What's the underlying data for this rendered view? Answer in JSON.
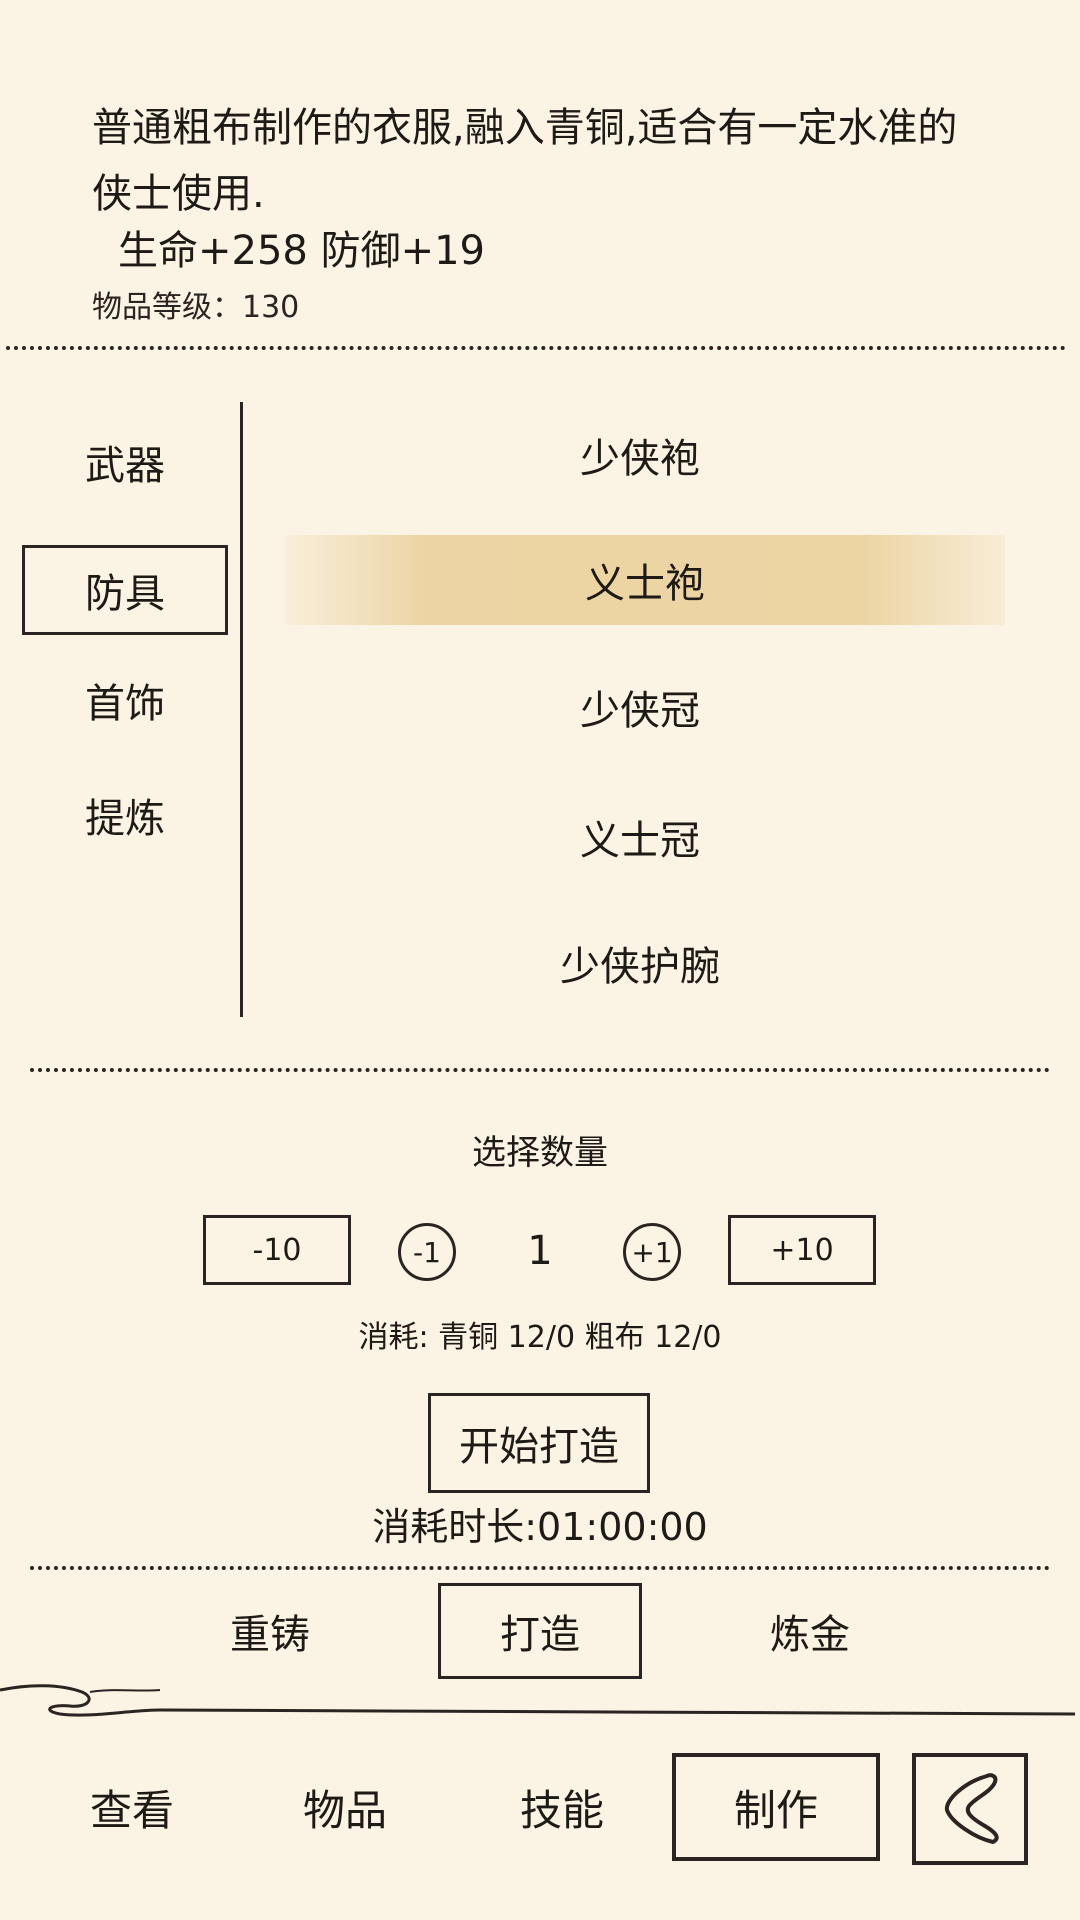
{
  "item_detail": {
    "description": "普通粗布制作的衣服,融入青铜,适合有一定水准的侠士使用.",
    "stats": "生命+258 防御+19",
    "level_text": "物品等级：130"
  },
  "categories": [
    {
      "label": "武器",
      "active": false
    },
    {
      "label": "防具",
      "active": true
    },
    {
      "label": "首饰",
      "active": false
    },
    {
      "label": "提炼",
      "active": false
    }
  ],
  "items": [
    {
      "label": "少侠袍",
      "selected": false
    },
    {
      "label": "义士袍",
      "selected": true
    },
    {
      "label": "少侠冠",
      "selected": false
    },
    {
      "label": "义士冠",
      "selected": false
    },
    {
      "label": "少侠护腕",
      "selected": false
    }
  ],
  "quantity": {
    "title": "选择数量",
    "minus10": "-10",
    "minus1": "-1",
    "value": "1",
    "plus1": "+1",
    "plus10": "+10",
    "cost": "消耗: 青铜 12/0 粗布 12/0"
  },
  "craft": {
    "button": "开始打造",
    "duration": "消耗时长:01:00:00"
  },
  "sub_tabs": [
    {
      "label": "重铸",
      "active": false
    },
    {
      "label": "打造",
      "active": true
    },
    {
      "label": "炼金",
      "active": false
    }
  ],
  "nav_tabs": [
    {
      "label": "查看",
      "active": false
    },
    {
      "label": "物品",
      "active": false
    },
    {
      "label": "技能",
      "active": false
    },
    {
      "label": "制作",
      "active": true
    }
  ],
  "icons": {
    "back": "back-chevron-icon"
  }
}
